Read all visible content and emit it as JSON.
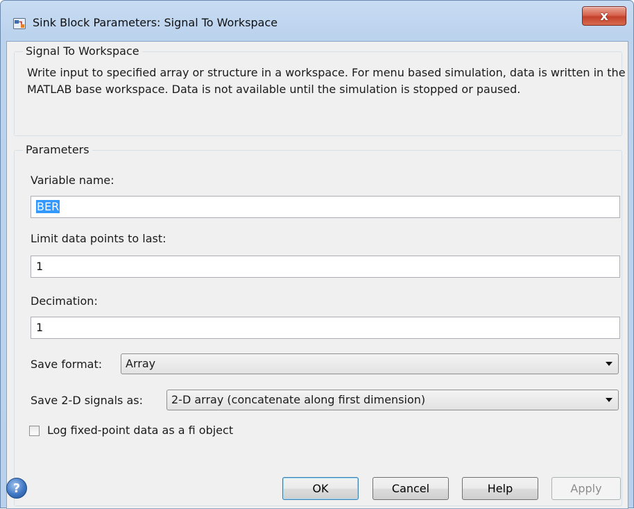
{
  "window": {
    "title": "Sink Block Parameters: Signal To Workspace",
    "close_glyph": "x",
    "icon": "simulink-block-icon"
  },
  "block_group": {
    "legend": "Signal To Workspace",
    "description": "Write input to specified array or structure in a workspace. For menu based simulation, data is written in the MATLAB base workspace. Data is not available until the simulation is stopped or paused."
  },
  "parameters": {
    "legend": "Parameters",
    "variable_name": {
      "label": "Variable name:",
      "value": "BER"
    },
    "limit_points": {
      "label": "Limit data points to last:",
      "value": "1"
    },
    "decimation": {
      "label": "Decimation:",
      "value": "1"
    },
    "save_format": {
      "label": "Save format:",
      "selected": "Array"
    },
    "save_2d": {
      "label": "Save 2-D signals as:",
      "selected": "2-D array (concatenate along first dimension)"
    },
    "log_fixed_point": {
      "label": "Log fixed-point data as a fi object",
      "checked": false
    }
  },
  "buttons": {
    "help_icon_glyph": "?",
    "ok": "OK",
    "cancel": "Cancel",
    "help": "Help",
    "apply": "Apply"
  }
}
